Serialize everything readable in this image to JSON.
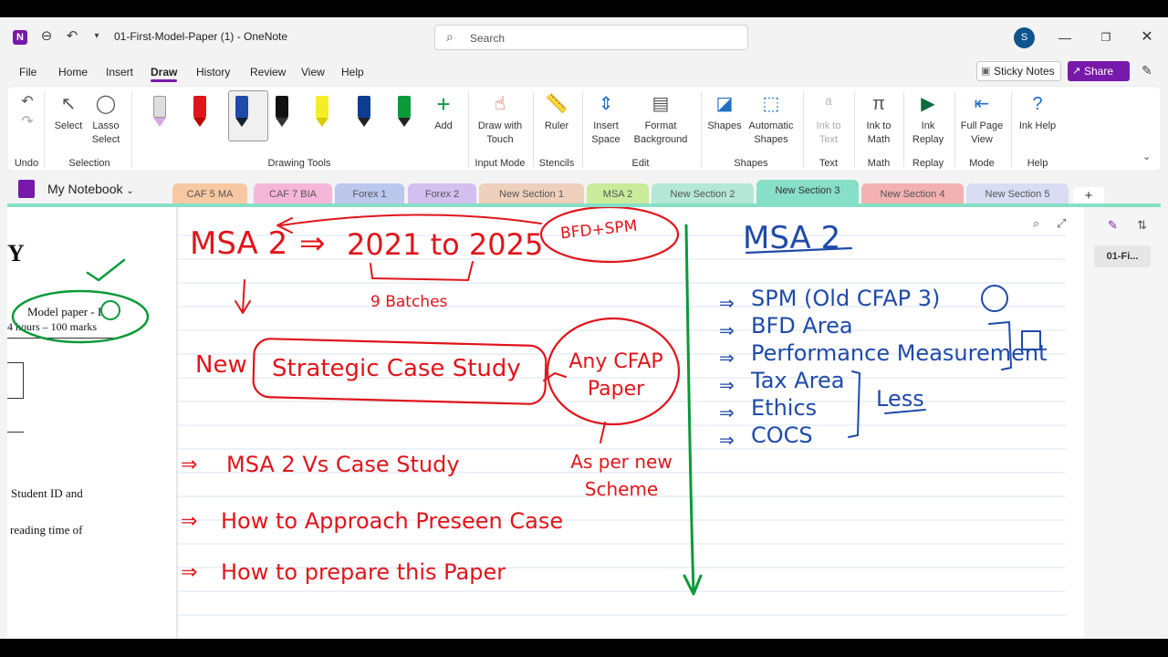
{
  "window": {
    "title": "01-First-Model-Paper (1)  -  OneNote",
    "search_placeholder": "Search",
    "avatar_initial": "S"
  },
  "menu": [
    "File",
    "Home",
    "Insert",
    "Draw",
    "History",
    "Review",
    "View",
    "Help"
  ],
  "menu_active": "Draw",
  "actions": {
    "sticky_notes": "Sticky Notes",
    "share": "Share"
  },
  "ribbon": {
    "undo_group": "Undo",
    "select": "Select",
    "lasso": "Lasso Select",
    "selection_group": "Selection",
    "drawing_tools_group": "Drawing Tools",
    "add": "Add",
    "draw_with_touch": "Draw with Touch",
    "input_mode_group": "Input Mode",
    "ruler": "Ruler",
    "stencils_group": "Stencils",
    "insert_space": "Insert Space",
    "format_background": "Format Background",
    "edit_group": "Edit",
    "shapes": "Shapes",
    "automatic_shapes": "Automatic Shapes",
    "shapes_group": "Shapes",
    "ink_to_text": "Ink to Text",
    "text_group": "Text",
    "ink_to_math": "Ink to Math",
    "math_group": "Math",
    "ink_replay": "Ink Replay",
    "replay_group": "Replay",
    "full_page_view": "Full Page View",
    "mode_group": "Mode",
    "ink_help": "Ink Help",
    "help_group": "Help"
  },
  "notebook": {
    "name": "My Notebook"
  },
  "sections": [
    {
      "label": "CAF 5 MA",
      "color": "#f7c8a1"
    },
    {
      "label": "CAF 7 BIA",
      "color": "#f6b6d9"
    },
    {
      "label": "Forex 1",
      "color": "#bcc7ee"
    },
    {
      "label": "Forex 2",
      "color": "#d4c0f0"
    },
    {
      "label": "New Section 1",
      "color": "#eed0bc"
    },
    {
      "label": "MSA 2",
      "color": "#c9eb9a"
    },
    {
      "label": "New Section 2",
      "color": "#b5e8d6"
    },
    {
      "label": "New Section 3",
      "color": "#86dfc6"
    },
    {
      "label": "New Section 4",
      "color": "#f3b1b1"
    },
    {
      "label": "New Section 5",
      "color": "#d9dcf3"
    }
  ],
  "active_section": "New Section 3",
  "pages": [
    "01-Fi..."
  ],
  "document": {
    "heading_fragment": "Y",
    "model_paper": "Model paper - I",
    "duration": "4 hours – 100 marks",
    "line1": "Student ID and",
    "line2": "reading time  of"
  },
  "ink_notes": {
    "left": [
      "MSA 2",
      "2021 to 2025",
      "BFD+SPM",
      "9 Batches",
      "New",
      "Strategic Case Study",
      "Any CFAP Paper",
      "MSA 2  Vs  Case Study",
      "As per new Scheme",
      "How to Approach Preseen Case",
      "How to prepare this Paper"
    ],
    "right": [
      "MSA 2",
      "SPM (Old CFAP 3)",
      "BFD Area",
      "Performance Measurement",
      "Tax Area",
      "Ethics",
      "COCS",
      "Less"
    ]
  },
  "colors": {
    "accent": "#7719aa",
    "ink_red": "#e0151b",
    "ink_blue": "#1f4aa8",
    "ink_green": "#0b9a3a"
  }
}
